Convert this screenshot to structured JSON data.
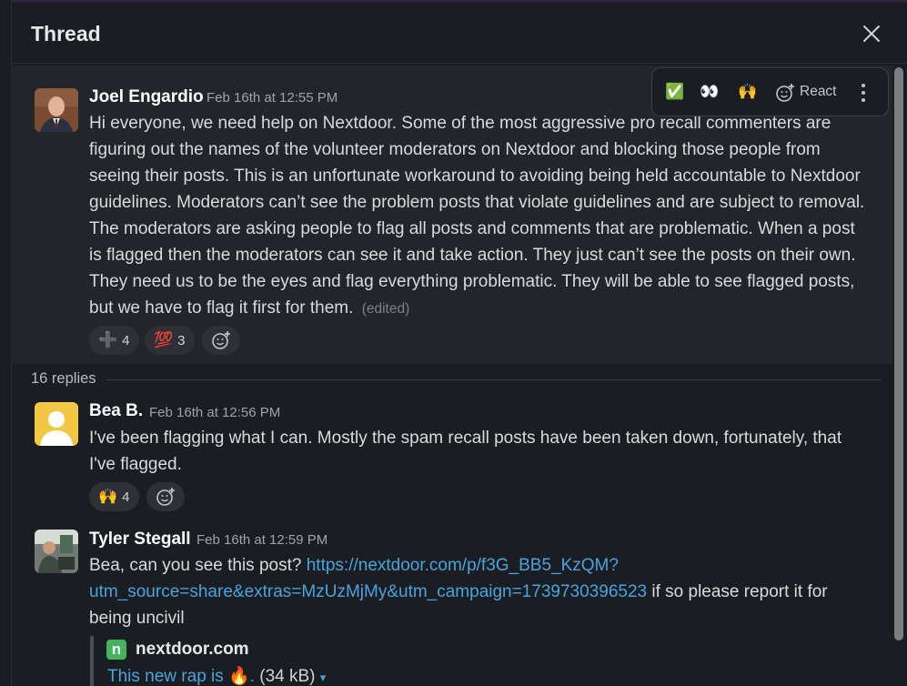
{
  "thread_title": "Thread",
  "toolbar": {
    "reactions": [
      "✅",
      "👀",
      "🙌"
    ],
    "react_label": "React"
  },
  "parent": {
    "author": "Joel Engardio",
    "timestamp": "Feb 16th at 12:55 PM",
    "lines": [
      "Hi everyone, we need help on Nextdoor. Some of the most aggressive pro recall commenters are",
      "figuring out the names of the volunteer moderators on Nextdoor and blocking those people from",
      "seeing their posts. This is an unfortunate workaround to avoiding being held accountable to Nextdoor",
      "guidelines. Moderators can’t see the problem posts that violate guidelines and are subject to removal.",
      "The moderators are asking people to flag all posts and comments that are problematic. When a post",
      "is flagged then the moderators can see it and take action. They just can’t see the posts on their own.",
      "They need us to be the eyes and flag everything problematic. They will be able to see flagged posts,",
      "but we have to flag it first for them."
    ],
    "edited": "(edited)",
    "reactions": [
      {
        "emoji": "➕",
        "count": "4"
      },
      {
        "emoji": "💯",
        "count": "3"
      }
    ]
  },
  "replies_count": "16 replies",
  "replies": [
    {
      "author": "Bea B.",
      "timestamp": "Feb 16th at 12:56 PM",
      "lines": [
        "I've been flagging what I can. Mostly the spam recall posts have been taken down, fortunately, that",
        "I've flagged."
      ],
      "reactions": [
        {
          "emoji": "🙌",
          "count": "4"
        }
      ]
    },
    {
      "author": "Tyler Stegall",
      "timestamp": "Feb 16th at 12:59 PM",
      "text_before": "Bea, can you see this post? ",
      "link_part1": "https://nextdoor.com/p/f3G_BB5_KzQM?",
      "link_part2": "utm_source=share&extras=MzUzMjMy&utm_campaign=1739730396523",
      "text_after": " if so please report it for",
      "text_last": "being uncivil",
      "preview": {
        "site": "nextdoor.com",
        "icon_letter": "n",
        "title": "This new rap is 🔥. ",
        "size": "(34 kB)"
      }
    }
  ]
}
